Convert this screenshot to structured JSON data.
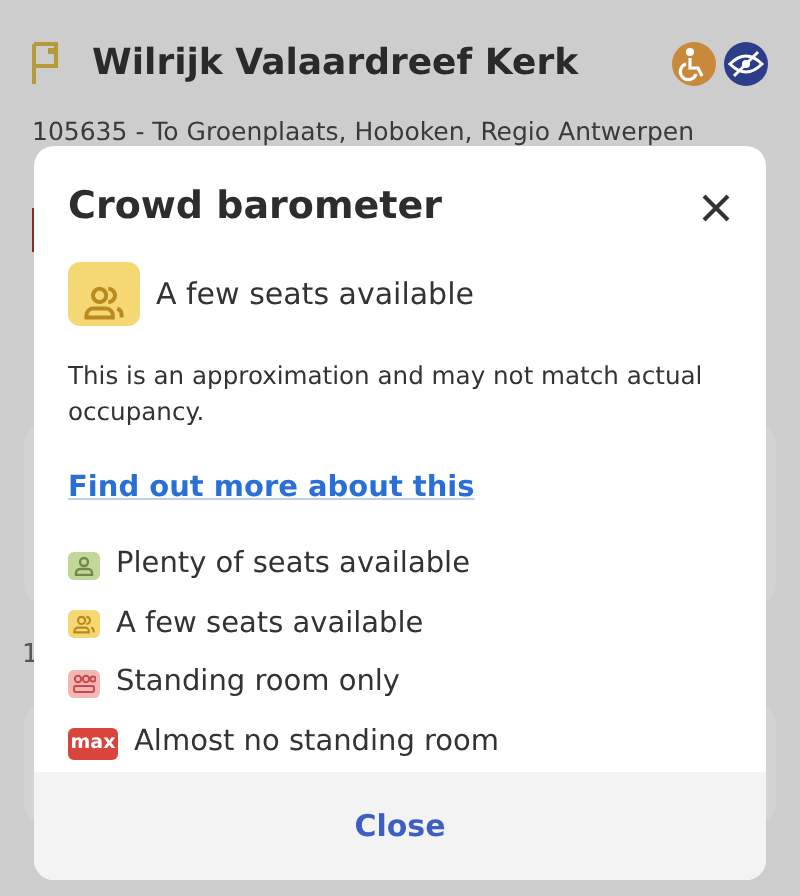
{
  "stop": {
    "name": "Wilrijk Valaardreef Kerk",
    "route": "105635 - To Groenplaats, Hoboken, Regio Antwerpen",
    "badges": [
      {
        "kind": "wheelchair",
        "color": "#c9893a"
      },
      {
        "kind": "eye",
        "color": "#2c3e8a"
      }
    ],
    "fragment": "1"
  },
  "dialog": {
    "title": "Crowd barometer",
    "current": {
      "kind": "few",
      "label": "A few seats available"
    },
    "note": "This is an approximation and may not match actual occupancy.",
    "link": "Find out more about this",
    "legend": [
      {
        "kind": "plenty",
        "color": "#c3d79a",
        "label": "Plenty of seats available"
      },
      {
        "kind": "few",
        "color": "#f5d874",
        "label": "A few seats available"
      },
      {
        "kind": "standing",
        "color": "#f2b6b4",
        "label": "Standing room only"
      },
      {
        "kind": "max",
        "color": "#d9443c",
        "label": "Almost no standing room",
        "badge_text": "max"
      }
    ],
    "close_button": "Close"
  }
}
